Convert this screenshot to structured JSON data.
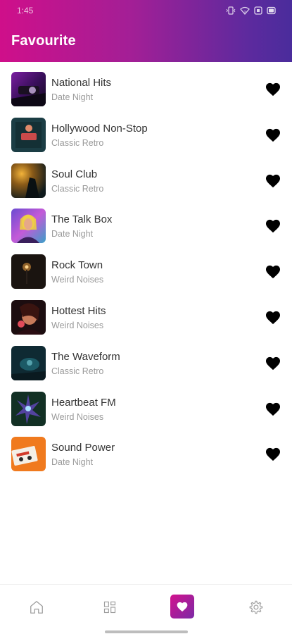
{
  "statusbar": {
    "time": "1:45"
  },
  "header": {
    "title": "Favourite"
  },
  "favourites": [
    {
      "name": "National Hits",
      "subtitle": "Date Night"
    },
    {
      "name": "Hollywood Non-Stop",
      "subtitle": "Classic Retro"
    },
    {
      "name": "Soul Club",
      "subtitle": "Classic Retro"
    },
    {
      "name": "The Talk Box",
      "subtitle": "Date Night"
    },
    {
      "name": "Rock Town",
      "subtitle": "Weird Noises"
    },
    {
      "name": "Hottest Hits",
      "subtitle": "Weird Noises"
    },
    {
      "name": "The Waveform",
      "subtitle": "Classic Retro"
    },
    {
      "name": "Heartbeat FM",
      "subtitle": "Weird Noises"
    },
    {
      "name": "Sound Power",
      "subtitle": "Date Night"
    }
  ],
  "nav": {
    "items": [
      "home-icon",
      "grid-icon",
      "heart-icon",
      "settings-icon"
    ],
    "active_index": 2
  },
  "colors": {
    "gradient_start": "#cf0f8a",
    "gradient_end": "#4a2c9c",
    "heart": "#000000"
  }
}
